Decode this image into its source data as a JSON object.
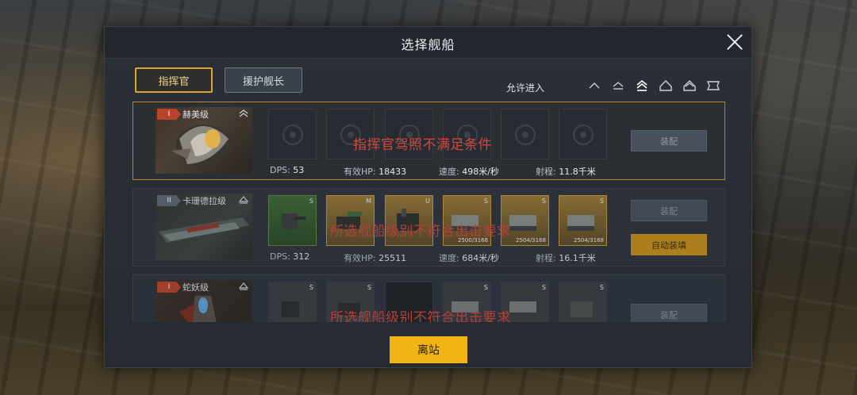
{
  "dialog": {
    "title": "选择舰船",
    "close_icon": "close-icon"
  },
  "tabs": [
    {
      "label": "指挥官",
      "active": true
    },
    {
      "label": "援护舰长",
      "active": false
    }
  ],
  "filter": {
    "label": "允许进入",
    "tier_icons": [
      "tier-1-icon",
      "tier-2-icon",
      "tier-3-icon",
      "tier-4-icon",
      "tier-5-icon",
      "tier-6-icon"
    ]
  },
  "ships": [
    {
      "tier": "I",
      "name": "赫美级",
      "stats": {
        "dps_label": "DPS:",
        "dps": "53",
        "hp_label": "有效HP:",
        "hp": "18433",
        "speed_label": "速度:",
        "speed": "498米/秒",
        "range_label": "射程:",
        "range": "11.8千米"
      },
      "warning": "指挥官驾照不满足条件",
      "buttons": [
        "装配"
      ]
    },
    {
      "tier": "II",
      "name": "卡珊德拉级",
      "stats": {
        "dps_label": "DPS:",
        "dps": "312",
        "hp_label": "有效HP:",
        "hp": "25511",
        "speed_label": "速度:",
        "speed": "684米/秒",
        "range_label": "射程:",
        "range": "16.1千米"
      },
      "slot_tags": [
        "S",
        "M",
        "U",
        "S",
        "S",
        "S"
      ],
      "ammo": [
        "",
        "",
        "",
        "2500/3168",
        "2504/3168",
        "2504/3168"
      ],
      "warning": "所选舰船级别不符合出击要求",
      "buttons": [
        "装配",
        "自动装填"
      ]
    },
    {
      "tier": "I",
      "name": "蛇妖级",
      "slot_tags": [
        "S",
        "S",
        "",
        "S",
        "S",
        "S"
      ],
      "warning": "所选舰船级别不符合出击要求",
      "buttons": [
        "装配"
      ]
    }
  ],
  "footer": {
    "leave_label": "离站"
  },
  "colors": {
    "accent": "#f0b415",
    "warning": "#d6453a",
    "selected_border": "#b4882c"
  }
}
